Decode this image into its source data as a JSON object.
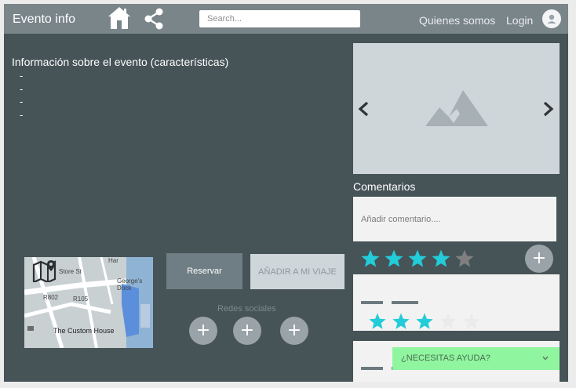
{
  "header": {
    "brand": "Evento info",
    "search_placeholder": "Search...",
    "nav": {
      "about": "Quienes somos",
      "login": "Login"
    }
  },
  "event": {
    "info_title": "Información sobre el evento (características)",
    "features": [
      "-",
      "-",
      "-",
      "-"
    ]
  },
  "comments": {
    "title": "Comentarios",
    "input_placeholder": "Añadir comentario....",
    "add_button": "+",
    "rating_input": 4,
    "rating_max": 5,
    "cards": [
      {
        "rating": 3,
        "rating_max": 5
      },
      {
        "rating": null
      }
    ]
  },
  "map": {
    "place_label": "The Custom House",
    "road_labels": [
      "R802",
      "R105",
      "Store St",
      "George's Dock",
      "Har"
    ]
  },
  "actions": {
    "reserve": "Reservar",
    "add_trip": "AÑADIR A MI VIAJE"
  },
  "social": {
    "title": "Redes sociales",
    "buttons": [
      "+",
      "+",
      "+"
    ]
  },
  "help": {
    "label": "¿NECESITAS AYUDA?"
  },
  "colors": {
    "background": "#465357",
    "header": "#7a858a",
    "star_active": "#22ccd8",
    "star_inactive": "#7f7f7f",
    "help_bg": "#8ff59e",
    "button_circle": "#9aa3a8"
  },
  "icons": {
    "home": "home-icon",
    "share": "share-icon",
    "avatar": "user-icon",
    "carousel_placeholder": "image-placeholder-icon",
    "prev": "chevron-left-icon",
    "next": "chevron-right-icon",
    "map": "map-pin-icon",
    "help_toggle": "chevron-down-icon"
  }
}
